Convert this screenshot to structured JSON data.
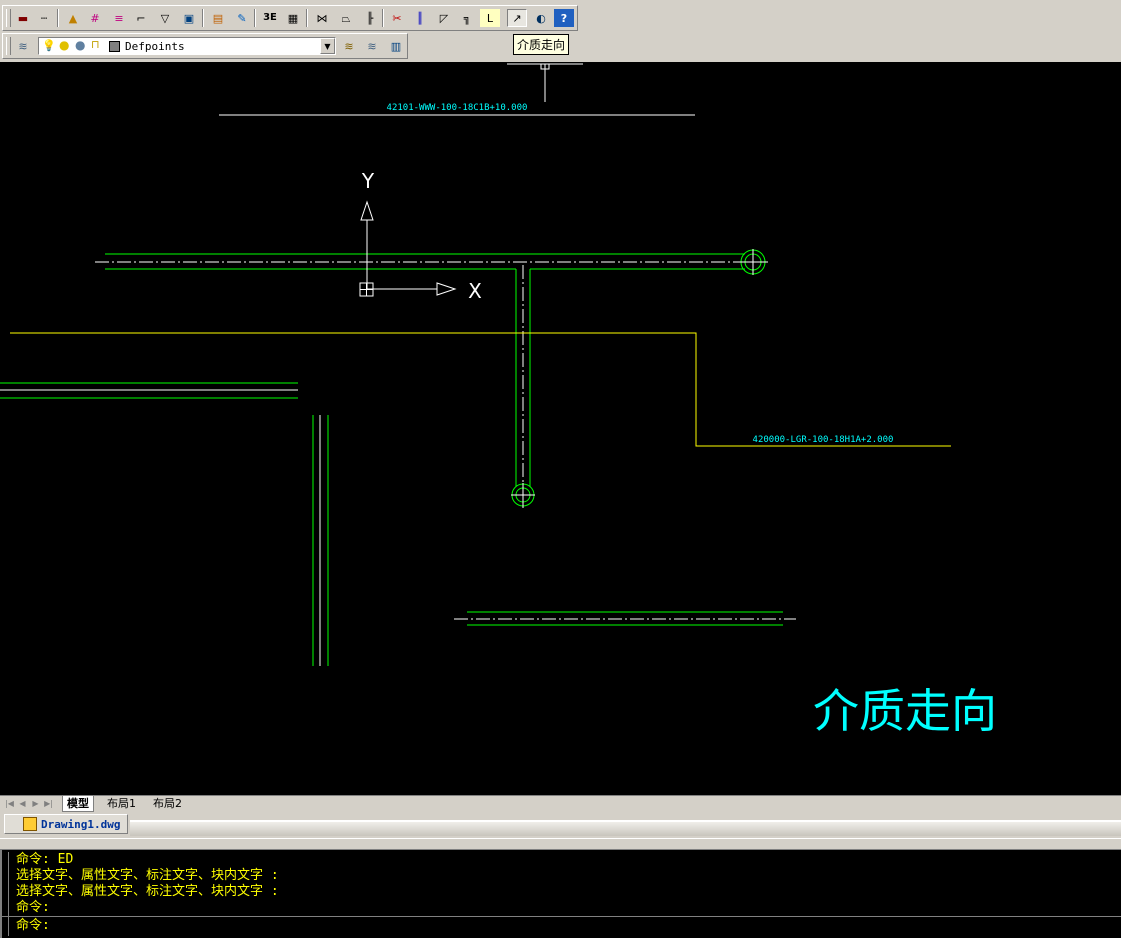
{
  "toolbar": {
    "row1_buttons": [
      "line-weight-icon",
      "linetype-icon",
      "draw-pipe-icon",
      "grid-pipe-icon",
      "pipe-tag-icon",
      "select-elbow-icon",
      "flange-icon",
      "layer-window-icon",
      "insert-block-icon",
      "brush-icon",
      "3e-label-icon",
      "table-grid-icon",
      "valve-icon",
      "reducer-icon",
      "branch-icon",
      "cut-icon",
      "parallel-icon",
      "rotate-icon",
      "bend-icon",
      "l-angle-icon",
      "flow-direction-icon",
      "globe-icon",
      "help-icon"
    ],
    "tooltip": "介质走向"
  },
  "layers": {
    "current_layer": "Defpoints"
  },
  "canvas": {
    "label_top": "42101-WWW-100-18C1B+10.000",
    "label_right": "420000-LGR-100-18H1A+2.000",
    "axis_y": "Y",
    "axis_x": "X",
    "big_text": "介质走向",
    "colors": {
      "background": "#000000",
      "pipe": "#00ff00",
      "centerline": "#ffffff",
      "leader": "#ffff00",
      "label": "#00ffff"
    }
  },
  "layout_tabs": [
    "模型",
    "布局1",
    "布局2"
  ],
  "document_tab": "Drawing1.dwg",
  "command_history": [
    "命令: ED",
    "选择文字、属性文字、标注文字、块内文字 :",
    "选择文字、属性文字、标注文字、块内文字 :",
    "命令:"
  ],
  "command_prompt": "命令:"
}
